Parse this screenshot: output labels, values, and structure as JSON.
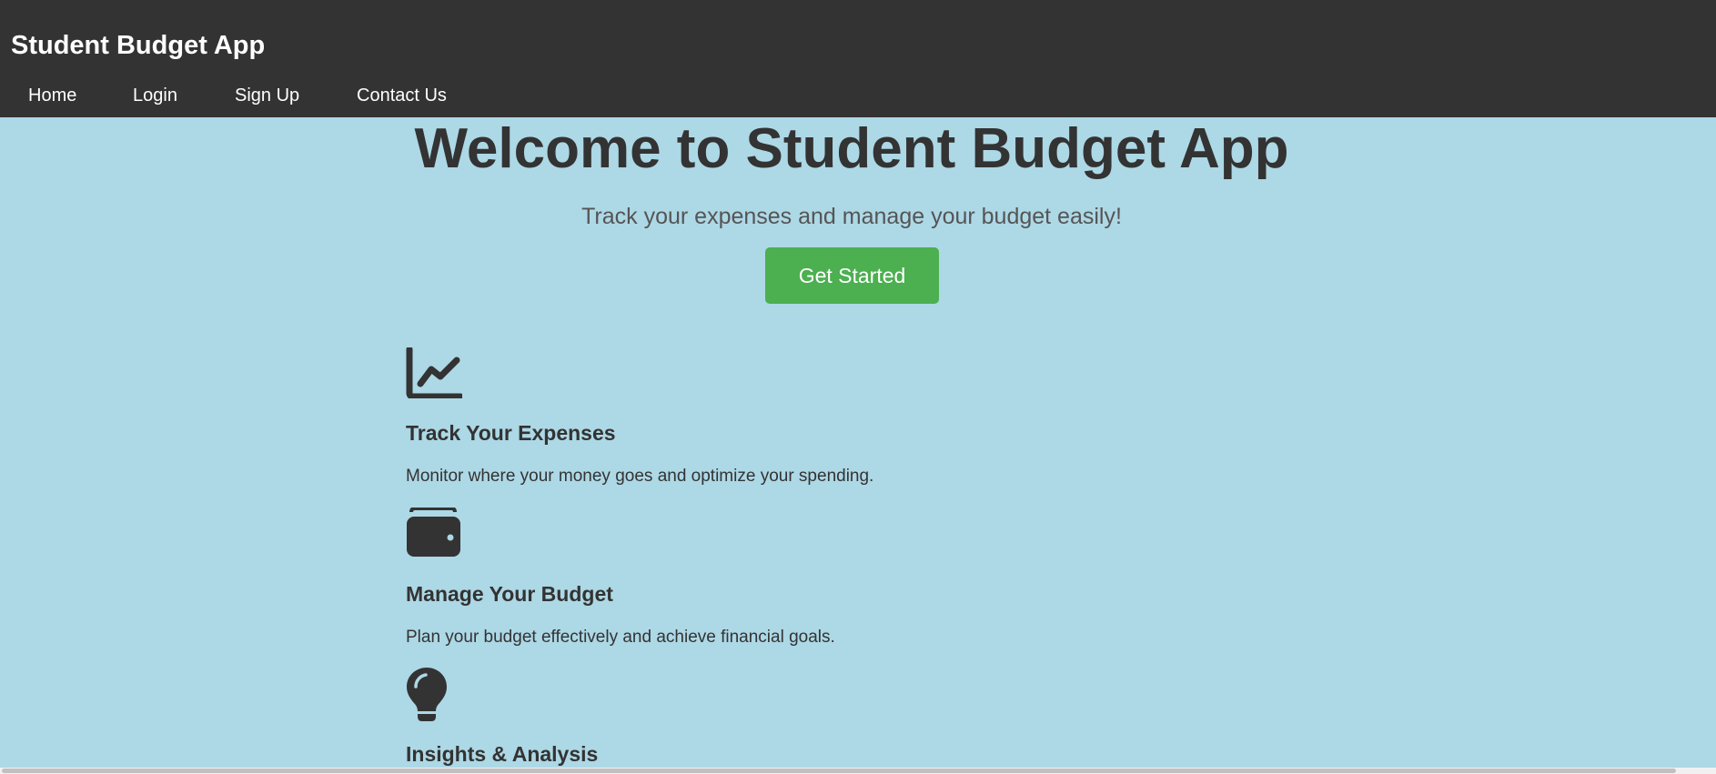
{
  "header": {
    "app_title": "Student Budget App",
    "nav": [
      "Home",
      "Login",
      "Sign Up",
      "Contact Us"
    ]
  },
  "hero": {
    "title": "Welcome to Student Budget App",
    "subtitle": "Track your expenses and manage your budget easily!",
    "cta_label": "Get Started"
  },
  "features": [
    {
      "icon": "chart-line-icon",
      "title": "Track Your Expenses",
      "description": "Monitor where your money goes and optimize your spending."
    },
    {
      "icon": "wallet-icon",
      "title": "Manage Your Budget",
      "description": "Plan your budget effectively and achieve financial goals."
    },
    {
      "icon": "lightbulb-icon",
      "title": "Insights & Analysis",
      "description": ""
    }
  ],
  "colors": {
    "header_bg": "#333333",
    "page_bg": "#add8e6",
    "accent": "#4caf50",
    "text": "#333333"
  }
}
